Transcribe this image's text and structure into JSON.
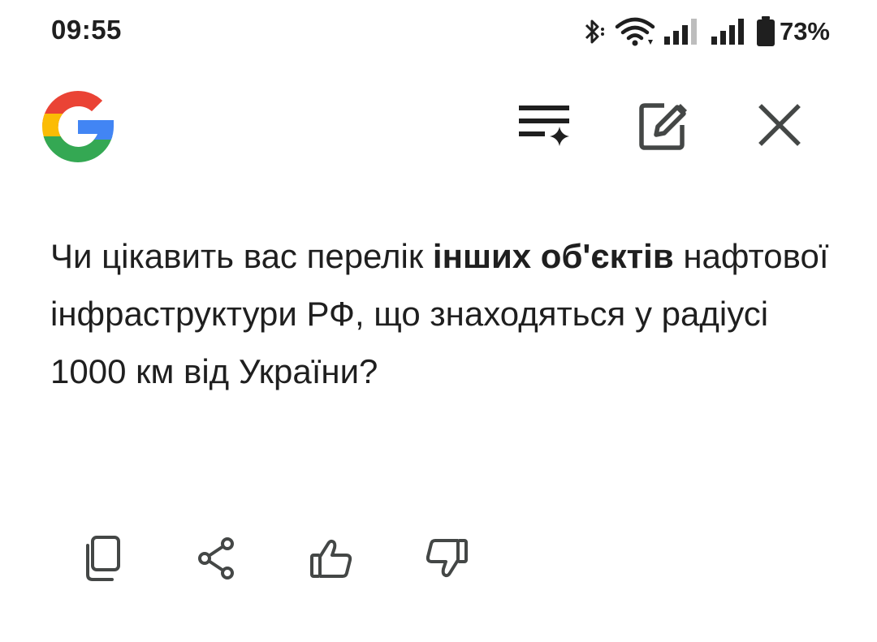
{
  "status_bar": {
    "time": "09:55",
    "battery_percent": "73%",
    "icons": [
      "bluetooth-icon",
      "wifi-icon",
      "signal-icon",
      "signal-icon",
      "battery-icon"
    ]
  },
  "header": {
    "logo": "google-g-logo",
    "buttons": [
      "refine-icon",
      "edit-icon",
      "close-icon"
    ]
  },
  "message": {
    "part1": "Чи цікавить вас перелік ",
    "bold": "інших об'єктів",
    "part2": " нафтової інфраструктури РФ, що знаходяться у радіусі 1000 км від України?"
  },
  "actions": [
    "copy-icon",
    "share-icon",
    "thumbs-up-icon",
    "thumbs-down-icon"
  ],
  "colors": {
    "text": "#1f1f1f",
    "icon": "#444746",
    "google_blue": "#4285F4",
    "google_red": "#EA4335",
    "google_yellow": "#FBBC05",
    "google_green": "#34A853"
  }
}
